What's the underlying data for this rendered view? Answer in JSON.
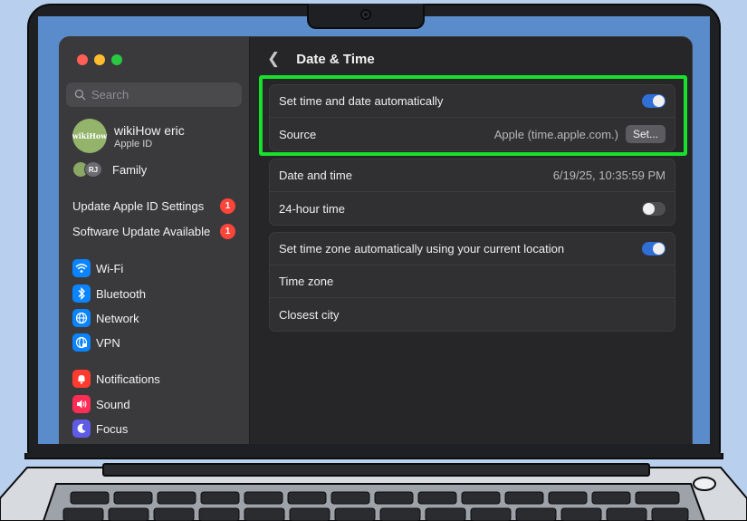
{
  "window": {
    "title": "Date & Time",
    "search_placeholder": "Search"
  },
  "sidebar": {
    "profile": {
      "name": "wikiHow eric",
      "subtitle": "Apple ID",
      "avatar_text": "wikiHow"
    },
    "family": {
      "label": "Family",
      "avatar_initials": "RJ"
    },
    "notices": [
      {
        "label": "Update Apple ID Settings",
        "badge": "1"
      },
      {
        "label": "Software Update Available",
        "badge": "1"
      }
    ],
    "items": [
      {
        "label": "Wi-Fi",
        "icon": "wifi-icon"
      },
      {
        "label": "Bluetooth",
        "icon": "bluetooth-icon"
      },
      {
        "label": "Network",
        "icon": "network-icon"
      },
      {
        "label": "VPN",
        "icon": "vpn-icon"
      },
      {
        "label": "Notifications",
        "icon": "notifications-icon"
      },
      {
        "label": "Sound",
        "icon": "sound-icon"
      },
      {
        "label": "Focus",
        "icon": "focus-icon"
      }
    ]
  },
  "main": {
    "auto_group": {
      "auto_label": "Set time and date automatically",
      "auto_enabled": true,
      "source_label": "Source",
      "source_value": "Apple (time.apple.com.)",
      "set_button": "Set..."
    },
    "time_group": {
      "date_label": "Date and time",
      "date_value": "6/19/25, 10:35:59 PM",
      "hour24_label": "24-hour time",
      "hour24_enabled": false
    },
    "zone_group": {
      "auto_zone_label": "Set time zone automatically using your current location",
      "auto_zone_enabled": true,
      "zone_label": "Time zone",
      "city_label": "Closest city"
    },
    "help": "?"
  },
  "colors": {
    "highlight": "#18e02c",
    "toggle_on": "#2f6fd6",
    "badge": "#ff453a",
    "background": "#b8cfee"
  }
}
